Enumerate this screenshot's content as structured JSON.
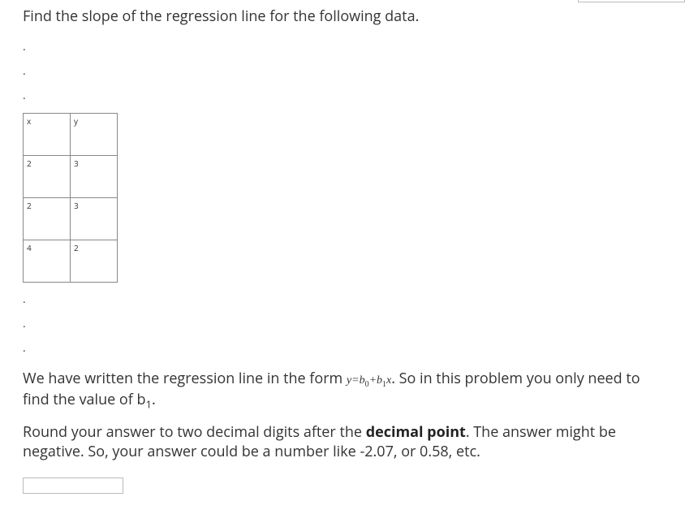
{
  "question": {
    "prompt": "Find the slope of the regression line for the following data.",
    "table": {
      "headerX": "x",
      "headerY": "y",
      "rows": [
        {
          "x": "2",
          "y": "3"
        },
        {
          "x": "2",
          "y": "3"
        },
        {
          "x": "4",
          "y": "2"
        }
      ]
    },
    "explain1_pre": "We have written the regression line in the form ",
    "formula_y": "y",
    "formula_eq": "=",
    "formula_b0": "b",
    "formula_b0_sub": "0",
    "formula_plus": "+",
    "formula_b1": "b",
    "formula_b1_sub": "1",
    "formula_x": "x",
    "explain1_post": ". So in this problem you only need to find the value of b",
    "explain1_sub": "1",
    "explain1_end": ".",
    "explain2_pre": "Round your answer to two decimal digits after the ",
    "explain2_strong": "decimal point",
    "explain2_post": ". The answer might be negative. So, your answer could be a number like -2.07, or 0.58, etc."
  },
  "dot": "."
}
